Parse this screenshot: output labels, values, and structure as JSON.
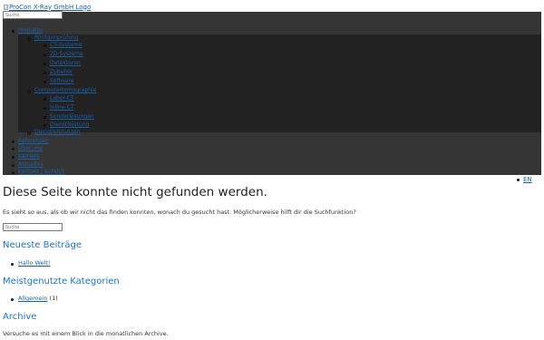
{
  "header": {
    "logo_alt": "ProCon X-Ray GmbH Logo",
    "search_placeholder": "Suche"
  },
  "nav": {
    "top_item": "Produkte",
    "groups": [
      {
        "label": "Röntgenprüfung",
        "items": [
          "CT-Systeme",
          "2D-Systeme",
          "Detektoren",
          "Zubehör",
          "Software"
        ]
      },
      {
        "label": "Computertomographie",
        "items": [
          "Labor-CT",
          "Inline-CT",
          "Sonderlösungen",
          "Dienstleistung"
        ]
      }
    ],
    "extra_item": "Dienstleistungen",
    "main_items": [
      "Referenzen",
      "Über uns",
      "Karriere",
      "Aktuelles",
      "Kontakt / Anfahrt"
    ],
    "language": "EN"
  },
  "main": {
    "title": "Diese Seite konnte nicht gefunden werden.",
    "message": "Es sieht so aus, als ob wir nicht das finden konnten, wonach du gesucht hast. Möglicherweise hilft dir die Suchfunktion?",
    "search_placeholder": "Suche"
  },
  "widgets": {
    "recent_posts": {
      "title": "Neueste Beiträge",
      "items": [
        "Hallo Welt!"
      ]
    },
    "categories": {
      "title": "Meistgenutzte Kategorien",
      "items": [
        {
          "name": "Allgemein",
          "count": "(1)"
        }
      ]
    },
    "archive": {
      "title": "Archive",
      "text": "Versuche es mit einem Blick in die monatlichen Archive."
    }
  },
  "colors": {
    "nav_bg": "#353535",
    "submenu_bg": "#222222",
    "link": "#1a5ea8",
    "widget_title": "#1a75c0"
  }
}
